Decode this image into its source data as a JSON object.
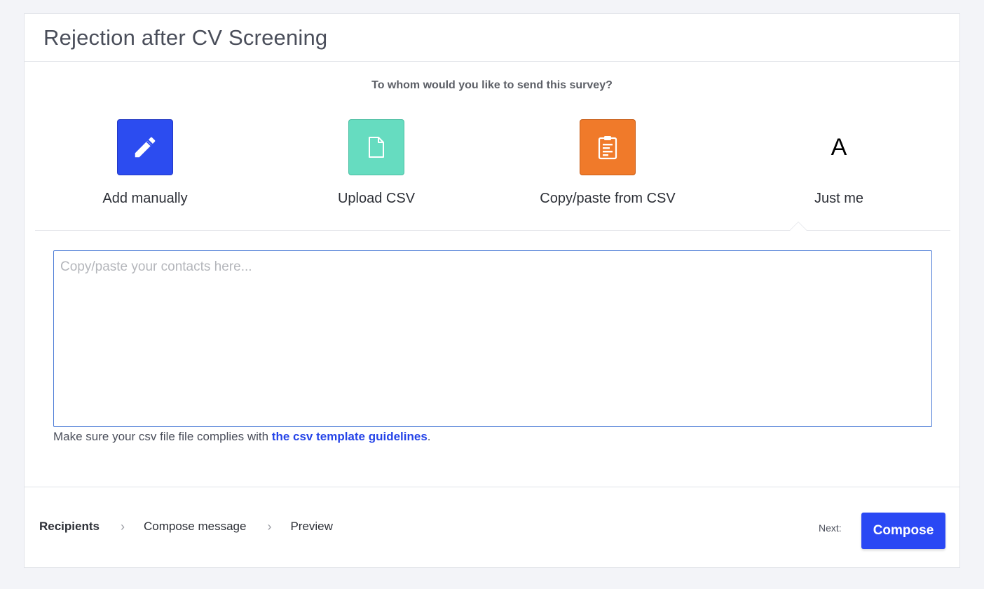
{
  "header": {
    "title": "Rejection after CV Screening"
  },
  "question": "To whom would you like to send this survey?",
  "options": [
    {
      "label": "Add manually",
      "icon": "pencil-icon",
      "color": "#2c4cf0"
    },
    {
      "label": "Upload CSV",
      "icon": "file-icon",
      "color": "#66dcc0"
    },
    {
      "label": "Copy/paste from CSV",
      "icon": "clipboard-icon",
      "color": "#f07a2a"
    },
    {
      "label": "Just me",
      "icon_text": "A"
    }
  ],
  "contacts": {
    "value": "",
    "placeholder": "Copy/paste your contacts here..."
  },
  "hint": {
    "text": "Make sure your csv file file complies with ",
    "link": "the csv template guidelines",
    "suffix": "."
  },
  "footer": {
    "steps": [
      "Recipients",
      "Compose message",
      "Preview"
    ],
    "next_label": "Next:",
    "compose_label": "Compose"
  }
}
